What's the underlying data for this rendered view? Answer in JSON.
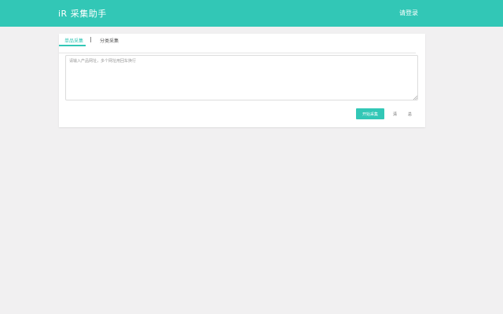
{
  "header": {
    "title": "iR 采集助手",
    "login_label": "请登录"
  },
  "tabs": [
    {
      "label": "单品采集",
      "active": true
    },
    {
      "label": "分类采集",
      "active": false
    }
  ],
  "input": {
    "placeholder": "请输入产品网址，多个网址用回车换行",
    "value": ""
  },
  "actions": {
    "start_label": "开始采集",
    "link_one": "清",
    "link_two": "总"
  },
  "colors": {
    "accent": "#32c7b6",
    "background": "#f1f0f1"
  }
}
